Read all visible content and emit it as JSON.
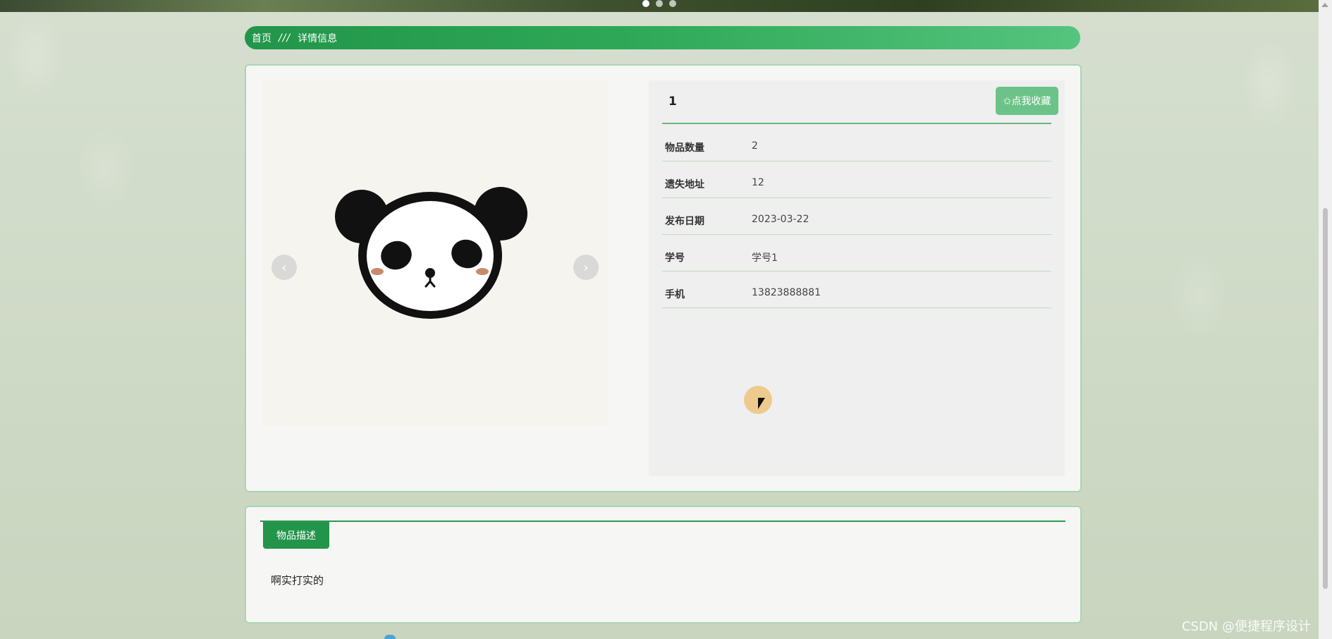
{
  "banner": {
    "dots": 3
  },
  "breadcrumb": {
    "home": "首页",
    "separator": "///",
    "current": "详情信息"
  },
  "detail": {
    "title": "1",
    "favorite_label": "✩点我收藏",
    "rows": [
      {
        "label": "物品数量",
        "value": "2"
      },
      {
        "label": "遗失地址",
        "value": "12"
      },
      {
        "label": "发布日期",
        "value": "2023-03-22"
      },
      {
        "label": "学号",
        "value": "学号1"
      },
      {
        "label": "手机",
        "value": "13823888881"
      }
    ],
    "carousel": {
      "prev_icon": "‹",
      "next_icon": "›"
    },
    "image_icon": "panda-image"
  },
  "description": {
    "tab_label": "物品描述",
    "text": "啊实打实的"
  },
  "watermark": "CSDN @便捷程序设计",
  "colors": {
    "primary": "#23954b",
    "accent_light": "#6cc389",
    "border": "#a8d6b2"
  }
}
